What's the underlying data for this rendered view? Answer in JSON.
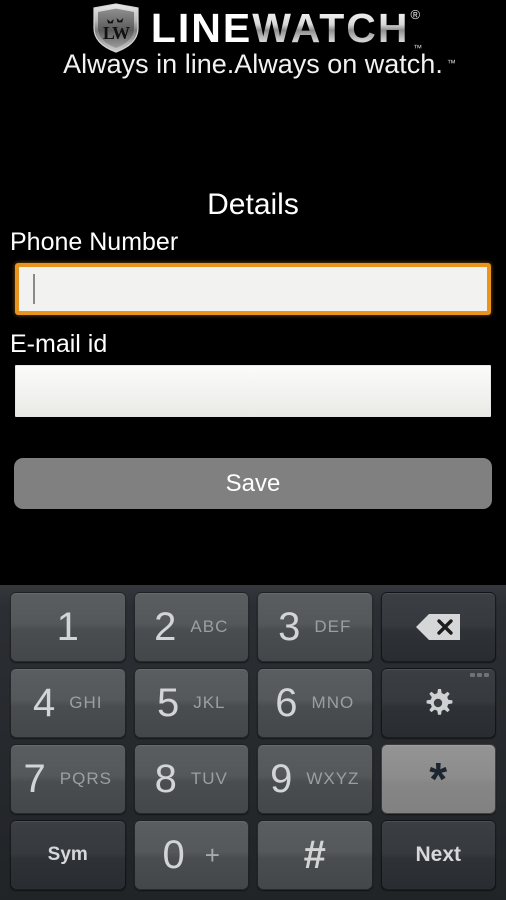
{
  "app": {
    "logo": {
      "shield_icon": "shield-lw-emblem-icon",
      "brand_part1": "LINE",
      "brand_part2": "WATCH",
      "registered_mark": "®",
      "trademark_mark": "™",
      "tagline": "Always in line.Always on watch.",
      "tagline_trademark": "™"
    },
    "screen_title": "Details",
    "fields": [
      {
        "label": "Phone Number",
        "value": "",
        "placeholder": "",
        "focused": true,
        "focus_color": "#E8941E"
      },
      {
        "label": "E-mail id",
        "value": "",
        "placeholder": "",
        "focused": false
      }
    ],
    "save_label": "Save",
    "save_color": "#808080",
    "background_color": "#000000"
  },
  "keyboard": {
    "type": "android-numeric-phone-keypad",
    "background_color": "#2B2E32",
    "rows": [
      [
        {
          "name": "key-1",
          "glyph": "1",
          "sub": "",
          "style": "num"
        },
        {
          "name": "key-2",
          "glyph": "2",
          "sub": "ABC",
          "style": "num"
        },
        {
          "name": "key-3",
          "glyph": "3",
          "sub": "DEF",
          "style": "num"
        },
        {
          "name": "key-backspace",
          "glyph": "",
          "sub": "",
          "style": "fn",
          "icon": "backspace-icon"
        }
      ],
      [
        {
          "name": "key-4",
          "glyph": "4",
          "sub": "GHI",
          "style": "num"
        },
        {
          "name": "key-5",
          "glyph": "5",
          "sub": "JKL",
          "style": "num"
        },
        {
          "name": "key-6",
          "glyph": "6",
          "sub": "MNO",
          "style": "num"
        },
        {
          "name": "key-settings",
          "glyph": "",
          "sub": "",
          "style": "fn",
          "icon": "gear-icon",
          "has_more_dots": true
        }
      ],
      [
        {
          "name": "key-7",
          "glyph": "7",
          "sub": "PQRS",
          "style": "num"
        },
        {
          "name": "key-8",
          "glyph": "8",
          "sub": "TUV",
          "style": "num"
        },
        {
          "name": "key-9",
          "glyph": "9",
          "sub": "WXYZ",
          "style": "num"
        },
        {
          "name": "key-asterisk",
          "glyph": "*",
          "sub": "",
          "style": "hi",
          "highlighted": true
        }
      ],
      [
        {
          "name": "key-sym",
          "word": "Sym",
          "style": "fn"
        },
        {
          "name": "key-0",
          "glyph": "0",
          "plus": "+",
          "style": "num"
        },
        {
          "name": "key-hash",
          "hash": "#",
          "style": "num"
        },
        {
          "name": "key-next",
          "word": "Next",
          "style": "fn"
        }
      ]
    ]
  }
}
